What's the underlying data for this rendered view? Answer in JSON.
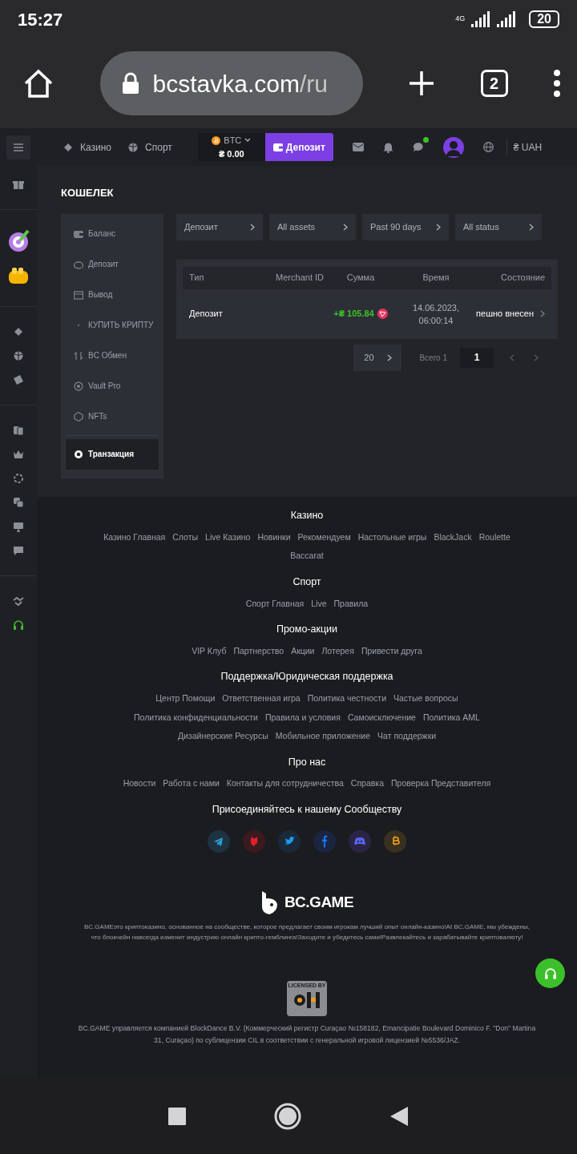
{
  "status_bar": {
    "time": "15:27",
    "network": "4G",
    "battery": "20"
  },
  "browser": {
    "url_host": "bcstavka.com",
    "url_path": "/ru",
    "tab_count": "2"
  },
  "header": {
    "nav": [
      {
        "label": "Казино"
      },
      {
        "label": "Спорт"
      }
    ],
    "currency": "BTC",
    "balance": "₴ 0.00",
    "deposit_button": "Депозит",
    "chat_unread": true,
    "fiat": "₴ UAH"
  },
  "wallet": {
    "title": "КОШЕЛЕК",
    "menu": [
      {
        "label": "Баланс",
        "kind": "wallet",
        "selected": false
      },
      {
        "label": "Депозит",
        "kind": "piggy",
        "selected": false
      },
      {
        "label": "Вывод",
        "kind": "box",
        "selected": false
      },
      {
        "label": "КУПИТЬ КРИПТУ",
        "kind": "dot",
        "selected": false
      },
      {
        "label": "BC Обмен",
        "kind": "swap",
        "selected": false
      },
      {
        "label": "Vault Pro",
        "kind": "vault",
        "selected": false
      },
      {
        "label": "NFTs",
        "kind": "hex",
        "selected": false
      },
      {
        "label": "Транзакция",
        "kind": "coin",
        "selected": true
      }
    ],
    "filters": [
      "Депозит",
      "All assets",
      "Past 90 days",
      "All status"
    ],
    "table": {
      "columns": [
        "Тип",
        "Merchant ID",
        "Сумма",
        "Время",
        "Состояние"
      ],
      "rows": [
        {
          "type": "Депозит",
          "amount": "+₴ 105.84",
          "time": "14.06.2023, 06:00:14",
          "status": "пешно внесен"
        }
      ]
    },
    "pagination": {
      "page_size": "20",
      "total": "Всего 1",
      "page": "1",
      "prev_disabled": true,
      "next_disabled": true
    }
  },
  "footer": {
    "sections": [
      {
        "title": "Казино",
        "links": [
          "Казино Главная",
          "Слоты",
          "Live Казино",
          "Новинки",
          "Рекомендуем",
          "Настольные игры",
          "BlackJack",
          "Roulette",
          "Baccarat"
        ]
      },
      {
        "title": "Спорт",
        "links": [
          "Спорт Главная",
          "Live",
          "Правила"
        ]
      },
      {
        "title": "Промо-акции",
        "links": [
          "VIP Клуб",
          "Партнерство",
          "Акции",
          "Лотерея",
          "Привести друга"
        ]
      },
      {
        "title": "Поддержка/Юридическая поддержка",
        "links": [
          "Центр Помощи",
          "Ответственная игра",
          "Политика честности",
          "Частые вопросы",
          "Политика конфиденциальности",
          "Правила и условия",
          "Самоисключение",
          "Политика AML",
          "Дизайнерские Ресурсы",
          "Мобильное приложение",
          "Чат поддержки"
        ]
      },
      {
        "title": "Про нас",
        "links": [
          "Новости",
          "Работа с нами",
          "Контакты для сотрудничества",
          "Справка",
          "Проверка Представителя"
        ]
      }
    ],
    "community_title": "Присоединяйтесь к нашему Сообществу",
    "brand": "BC.GAME",
    "about": "BC.GAMEэто криптоказино, основанное на сообществе, которое предлагает своим игрокам лучший опыт онлайн-казино!At BC.GAME, мы убеждены, что блокчейн навсегда изменит индустрию онлайн крипто-гемблинга!Заходите и убедитесь сами!Развлекайтесь и зарабатывайте криптовалюту!",
    "license_badge": "LICENSED BY",
    "license": "BC.GAME управляется компанией BlockDance B.V. (Коммерческий регистр Curaçao №158182, Emancipatie Boulevard Dominico F. \"Don\" Martina 31, Curaçao) по сублицензии CIL в соответствии с генеральной игровой лицензией №5536/JAZ."
  }
}
